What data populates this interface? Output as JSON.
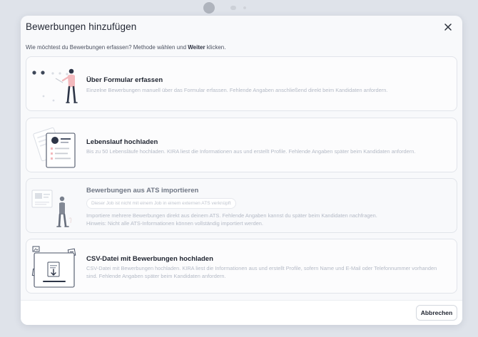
{
  "modal": {
    "title": "Bewerbungen hinzufügen",
    "intro_prefix": "Wie möchtest du Bewerbungen erfassen? Methode wählen und ",
    "intro_bold": "Weiter",
    "intro_suffix": " klicken."
  },
  "options": [
    {
      "title": "Über Formular erfassen",
      "description": "Einzelne Bewerbungen manuell über das Formular erfassen. Fehlende Angaben anschließend direkt beim Kandidaten anfordern.",
      "icon": "person-form-illustration"
    },
    {
      "title": "Lebenslauf hochladen",
      "description": "Bis zu 50 Lebensläufe hochladen. KIRA liest die Informationen aus und erstellt Profile. Fehlende Angaben später beim Kandidaten anfordern.",
      "icon": "resume-documents-illustration"
    },
    {
      "title": "Bewerbungen aus ATS importieren",
      "hint": "Dieser Job ist nicht mit einem Job in einem externen ATS verknüpft",
      "description_line1": "Importiere mehrere Bewerbungen direkt aus deinem ATS. Fehlende Angaben kannst du später beim Kandidaten nachfragen.",
      "description_line2": "Hinweis: Nicht alle ATS-Informationen können vollständig importiert werden.",
      "icon": "person-board-illustration",
      "disabled": true
    },
    {
      "title": "CSV-Datei mit Bewerbungen hochladen",
      "description": "CSV-Datei mit Bewerbungen hochladen. KIRA liest die Informationen aus und erstellt Profile, sofern Name und E-Mail oder Telefonnummer vorhanden sind. Fehlende Angaben später beim Kandidaten anfordern.",
      "icon": "csv-upload-illustration"
    }
  ],
  "footer": {
    "cancel_label": "Abbrechen"
  },
  "colors": {
    "accent": "#2b3a55",
    "illustration_pink": "#f3b9bd",
    "muted_text": "#b4bac6"
  }
}
